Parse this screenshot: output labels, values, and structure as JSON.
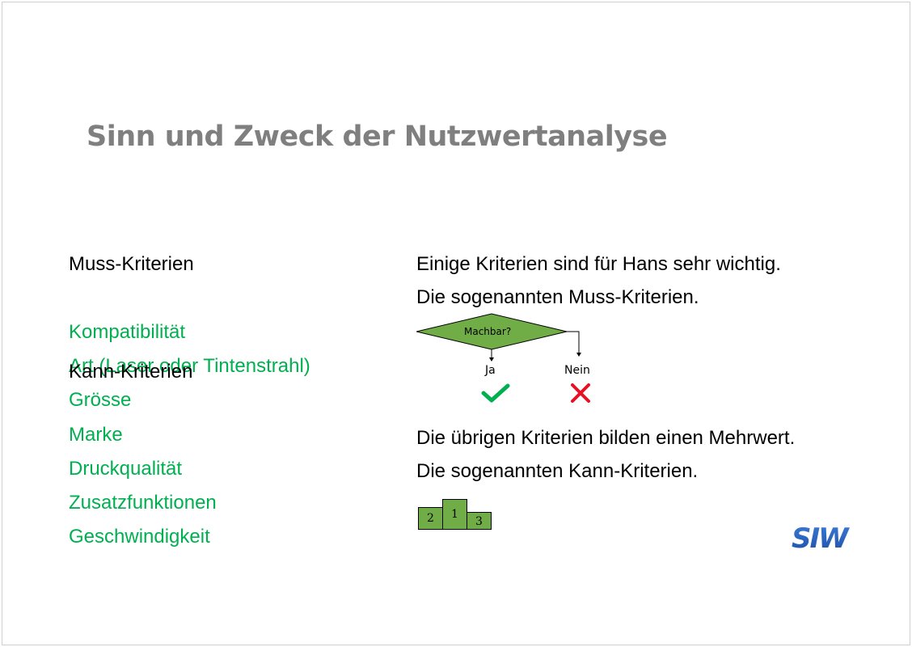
{
  "slide": {
    "title": "Sinn und Zweck der Nutzwertanalyse",
    "left": {
      "muss_heading": "Muss-Kriterien",
      "kann_heading": "Kann-Kriterien",
      "criteria": [
        "Kompatibilität",
        "Art (Laser oder Tintenstrahl)",
        "Grösse",
        "Marke",
        "Druckqualität",
        "Zusatzfunktionen",
        "Geschwindigkeit"
      ]
    },
    "right": {
      "line1": "Einige Kriterien sind für Hans sehr wichtig.",
      "line2": "Die sogenannten Muss-Kriterien.",
      "line3": "Die übrigen Kriterien bilden einen Mehrwert.",
      "line4": "Die sogenannten Kann-Kriterien."
    },
    "decision": {
      "question": "Machbar?",
      "yes_label": "Ja",
      "no_label": "Nein",
      "yes_icon": "check-icon",
      "no_icon": "cross-icon"
    },
    "podium": {
      "first": "1",
      "second": "2",
      "third": "3"
    },
    "logo": {
      "icon": "siw-logo",
      "text": "SIW"
    },
    "colors": {
      "green_text": "#00b050",
      "diamond_fill": "#70ad47",
      "check": "#00b050",
      "cross": "#e81123",
      "logo_blue": "#1f5fbf"
    }
  }
}
